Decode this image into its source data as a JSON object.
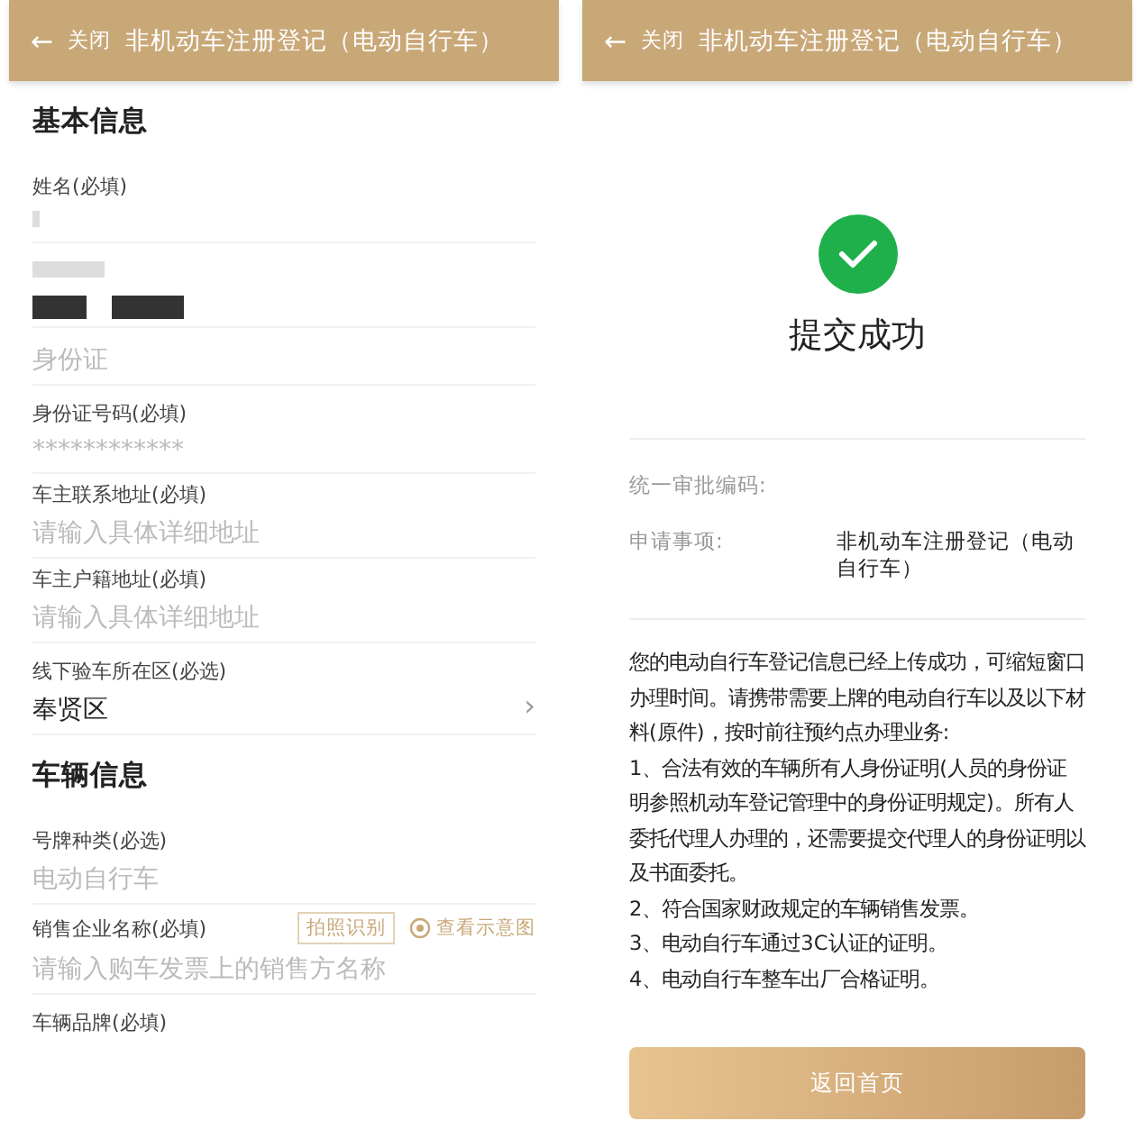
{
  "screens": [
    {
      "header": {
        "back": "←",
        "close": "关闭",
        "title": "非机动车注册登记（电动自行车）"
      },
      "sections": [
        {
          "title": "基本信息",
          "fields": [
            {
              "kind": "redacted",
              "label": "姓名(必填)"
            },
            {
              "kind": "redacted_both"
            },
            {
              "kind": "readonly",
              "value": "身份证"
            },
            {
              "kind": "readonly",
              "label": "身份证号码(必填)",
              "value": "************"
            },
            {
              "kind": "input",
              "label": "车主联系地址(必填)",
              "placeholder": "请输入具体详细地址"
            },
            {
              "kind": "input",
              "label": "车主户籍地址(必填)",
              "placeholder": "请输入具体详细地址"
            },
            {
              "kind": "select",
              "label": "线下验车所在区(必选)",
              "value": "奉贤区",
              "chevron": "›"
            }
          ]
        },
        {
          "title": "车辆信息",
          "fields": [
            {
              "kind": "readonly",
              "label": "号牌种类(必选)",
              "value": "电动自行车"
            },
            {
              "kind": "input",
              "label": "销售企业名称(必填)",
              "placeholder": "请输入购车发票上的销售方名称",
              "scan_button": "拍照识别",
              "sample_link": "查看示意图"
            },
            {
              "kind": "label_only",
              "label": "车辆品牌(必填)"
            }
          ]
        }
      ]
    },
    {
      "header": {
        "back": "←",
        "close": "关闭",
        "title": "非机动车注册登记（电动自行车）"
      },
      "result": {
        "title": "提交成功",
        "details": [
          {
            "label": "统一审批编码:"
          },
          {
            "label": "申请事项:",
            "value": "非机动车注册登记（电动自行车）"
          }
        ],
        "notice": [
          "您的电动自行车登记信息已经上传成功，可缩短窗口办理时间。请携带需要上牌的电动自行车以及以下材料(原件)，按时前往预约点办理业务:",
          "1、合法有效的车辆所有人身份证明(人员的身份证明参照机动车登记管理中的身份证明规定)。所有人委托代理人办理的，还需要提交代理人的身份证明以及书面委托。",
          "2、符合国家财政规定的车辆销售发票。",
          "3、电动自行车通过3C认证的证明。",
          "4、电动自行车整车出厂合格证明。"
        ],
        "button": "返回首页"
      }
    }
  ]
}
